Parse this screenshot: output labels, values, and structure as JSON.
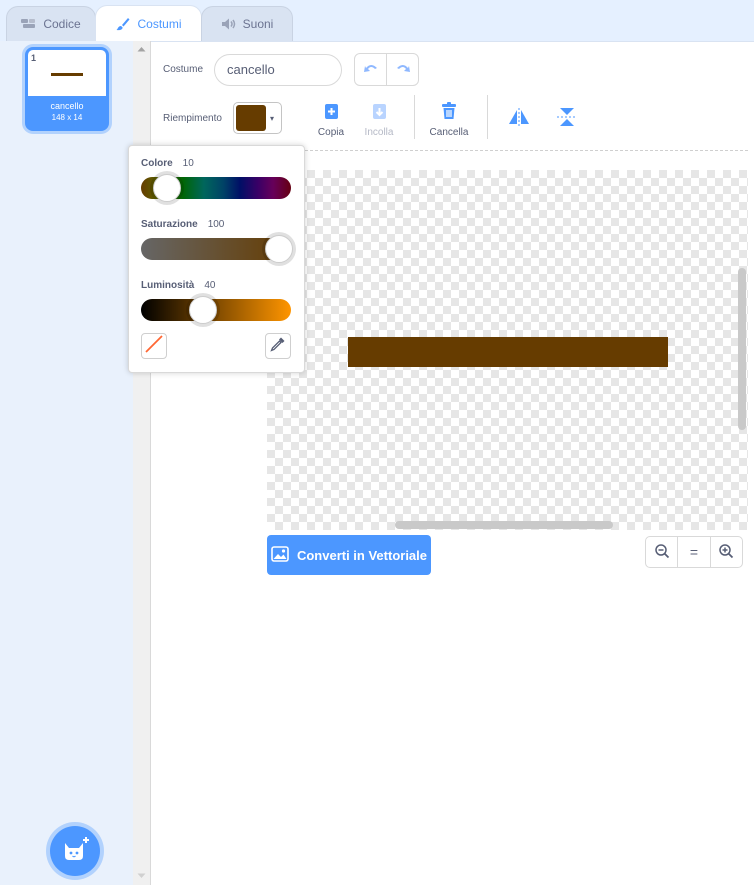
{
  "tabs": [
    {
      "label": "Codice",
      "icon": "code-icon"
    },
    {
      "label": "Costumi",
      "icon": "brush-icon"
    },
    {
      "label": "Suoni",
      "icon": "speaker-icon"
    }
  ],
  "costume_list": {
    "items": [
      {
        "number": "1",
        "name": "cancello",
        "size": "148 x 14"
      }
    ],
    "add_icon": "cat-add-icon"
  },
  "editor": {
    "costume_label": "Costume",
    "costume_name": "cancello",
    "fill_label": "Riempimento",
    "fill_color": "#663c00",
    "tools": {
      "copy": "Copia",
      "paste": "Incolla",
      "delete": "Cancella"
    },
    "convert_button": "Converti in Vettoriale",
    "zoom": {
      "out": "−",
      "reset": "=",
      "in": "+"
    }
  },
  "color_picker": {
    "color": {
      "label": "Colore",
      "value": "10"
    },
    "saturation": {
      "label": "Saturazione",
      "value": "100"
    },
    "brightness": {
      "label": "Luminosità",
      "value": "40"
    }
  },
  "colors": {
    "accent": "#4c97ff",
    "fill": "#663c00"
  }
}
